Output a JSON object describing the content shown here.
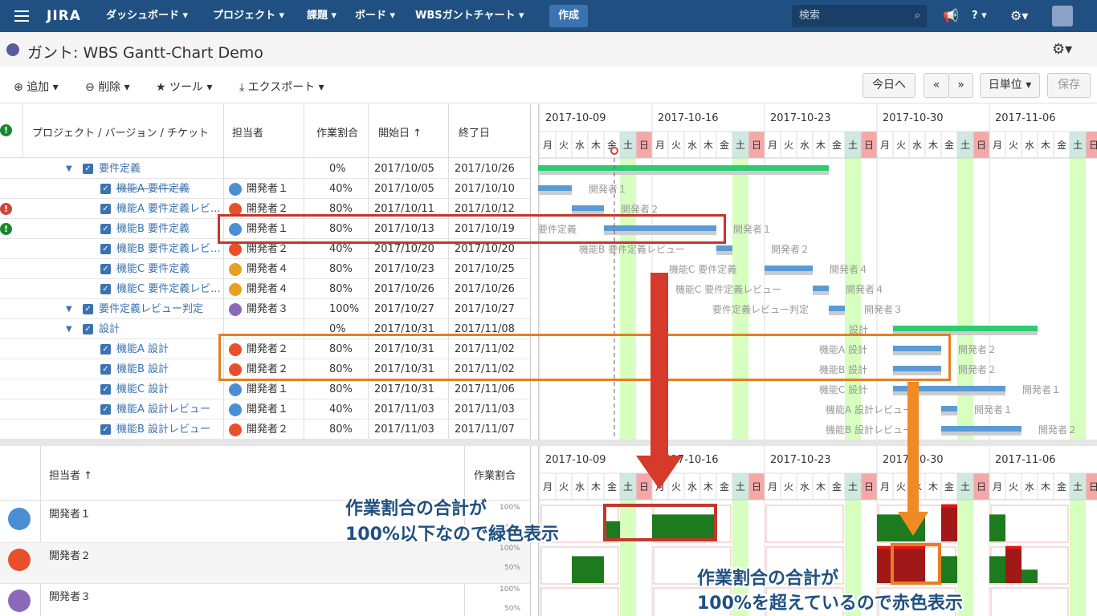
{
  "nav": {
    "logo": "JIRA",
    "items": [
      "ダッシュボード",
      "プロジェクト",
      "課題",
      "ボード",
      "WBSガントチャート"
    ],
    "create": "作成",
    "search_placeholder": "検索"
  },
  "page": {
    "title": "ガント: WBS Gantt-Chart Demo"
  },
  "toolbar": {
    "add": "追加",
    "delete": "削除",
    "tools": "ツール",
    "export": "エクスポート",
    "today": "今日へ",
    "prev": "«",
    "next": "»",
    "unit": "日単位",
    "save": "保存"
  },
  "columns": {
    "project": "プロジェクト / バージョン / チケット",
    "assignee": "担当者",
    "ratio": "作業割合",
    "start": "開始日 ↑",
    "end": "終了日"
  },
  "weeks": [
    "2017-10-09",
    "2017-10-16",
    "2017-10-23",
    "2017-10-30",
    "2017-11-06"
  ],
  "weekdays": [
    "月",
    "火",
    "水",
    "木",
    "金",
    "土",
    "日"
  ],
  "rows": [
    {
      "name": "要件定義",
      "assignee": "",
      "ratio": "0%",
      "start": "2017/10/05",
      "end": "2017/10/26",
      "level": 1,
      "alert": ""
    },
    {
      "name": "機能A 要件定義",
      "assignee": "開発者１",
      "ratio": "40%",
      "start": "2017/10/05",
      "end": "2017/10/10",
      "level": 2,
      "alert": ""
    },
    {
      "name": "機能A 要件定義レビ...",
      "assignee": "開発者２",
      "ratio": "80%",
      "start": "2017/10/11",
      "end": "2017/10/12",
      "level": 2,
      "alert": "!"
    },
    {
      "name": "機能B 要件定義",
      "assignee": "開発者１",
      "ratio": "80%",
      "start": "2017/10/13",
      "end": "2017/10/19",
      "level": 2,
      "alert": "!"
    },
    {
      "name": "機能B 要件定義レビ...",
      "assignee": "開発者２",
      "ratio": "40%",
      "start": "2017/10/20",
      "end": "2017/10/20",
      "level": 2,
      "alert": ""
    },
    {
      "name": "機能C 要件定義",
      "assignee": "開発者４",
      "ratio": "80%",
      "start": "2017/10/23",
      "end": "2017/10/25",
      "level": 2,
      "alert": ""
    },
    {
      "name": "機能C 要件定義レビ...",
      "assignee": "開発者４",
      "ratio": "80%",
      "start": "2017/10/26",
      "end": "2017/10/26",
      "level": 2,
      "alert": ""
    },
    {
      "name": "要件定義レビュー判定",
      "assignee": "開発者３",
      "ratio": "100%",
      "start": "2017/10/27",
      "end": "2017/10/27",
      "level": 1,
      "alert": ""
    },
    {
      "name": "設計",
      "assignee": "",
      "ratio": "0%",
      "start": "2017/10/31",
      "end": "2017/11/08",
      "level": 1,
      "alert": ""
    },
    {
      "name": "機能A 設計",
      "assignee": "開発者２",
      "ratio": "80%",
      "start": "2017/10/31",
      "end": "2017/11/02",
      "level": 2,
      "alert": ""
    },
    {
      "name": "機能B 設計",
      "assignee": "開発者２",
      "ratio": "80%",
      "start": "2017/10/31",
      "end": "2017/11/02",
      "level": 2,
      "alert": ""
    },
    {
      "name": "機能C 設計",
      "assignee": "開発者１",
      "ratio": "80%",
      "start": "2017/10/31",
      "end": "2017/11/06",
      "level": 2,
      "alert": ""
    },
    {
      "name": "機能A 設計レビュー",
      "assignee": "開発者１",
      "ratio": "40%",
      "start": "2017/11/03",
      "end": "2017/11/03",
      "level": 2,
      "alert": ""
    },
    {
      "name": "機能B 設計レビュー",
      "assignee": "開発者２",
      "ratio": "80%",
      "start": "2017/11/03",
      "end": "2017/11/07",
      "level": 2,
      "alert": ""
    }
  ],
  "gantt_labels": [
    "開発者１",
    "開発者２",
    "要件定義",
    "開発者１",
    "機能B 要件定義レビュー",
    "開発者２",
    "機能C 要件定義",
    "開発者４",
    "機能C 要件定義レビュー",
    "開発者４",
    "要件定義レビュー判定",
    "開発者３",
    "設計",
    "機能A 設計",
    "開発者２",
    "機能B 設計",
    "開発者２",
    "機能C 設計",
    "開発者１",
    "機能A 設計レビュー",
    "開発者１",
    "機能B 設計レビュー",
    "開発者２"
  ],
  "resource": {
    "assignee_header": "担当者 ↑",
    "ratio_header": "作業割合",
    "people": [
      "開発者１",
      "開発者２",
      "開発者３"
    ],
    "axis": [
      "100%",
      "50%",
      "100%",
      "50%",
      "100%",
      "50%"
    ]
  },
  "callouts": {
    "green_1": "作業割合の合計が",
    "green_2": "100%以下なので緑色表示",
    "red_1": "作業割合の合計が",
    "red_2": "100%を超えているので赤色表示"
  },
  "colors": {
    "nav": "#205081",
    "link": "#3b73af",
    "green": "#1e7a1e",
    "over": "#a01818",
    "weekend_bg": "#d6ffc0"
  }
}
